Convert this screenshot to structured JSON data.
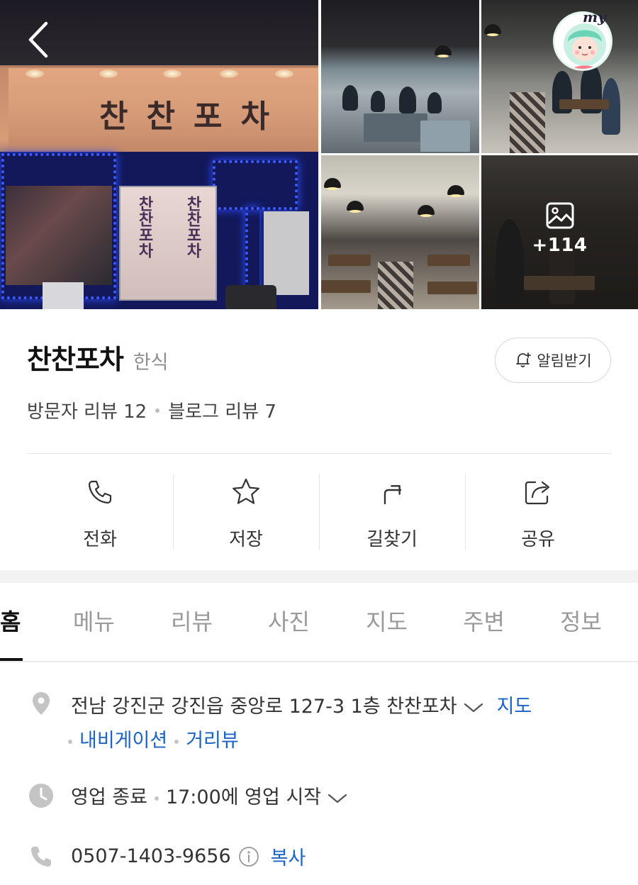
{
  "gallery": {
    "sign_text": "찬찬포차",
    "door_text": "찬찬포차",
    "more_photos": "+114",
    "my_badge": "my"
  },
  "place": {
    "name": "찬찬포차",
    "category": "한식",
    "notify_label": "알림받기",
    "visitor_reviews": "방문자 리뷰 12",
    "blog_reviews": "블로그 리뷰 7"
  },
  "actions": [
    {
      "label": "전화",
      "icon": "phone-icon"
    },
    {
      "label": "저장",
      "icon": "star-icon"
    },
    {
      "label": "길찾기",
      "icon": "directions-icon"
    },
    {
      "label": "공유",
      "icon": "share-icon"
    }
  ],
  "tabs": [
    "홈",
    "메뉴",
    "리뷰",
    "사진",
    "지도",
    "주변",
    "정보"
  ],
  "active_tab": "홈",
  "info": {
    "address": "전남 강진군 강진읍 중앙로 127-3 1층 찬찬포차",
    "map_link": "지도",
    "navigation_link": "내비게이션",
    "streetview_link": "거리뷰",
    "hours_status": "영업 종료",
    "hours_next": "17:00에 영업 시작",
    "phone": "0507-1403-9656",
    "copy_label": "복사"
  },
  "colors": {
    "link": "#1a63c7",
    "text_primary": "#111111",
    "text_secondary": "#8e8e8e",
    "divider": "#e6e6e6"
  }
}
